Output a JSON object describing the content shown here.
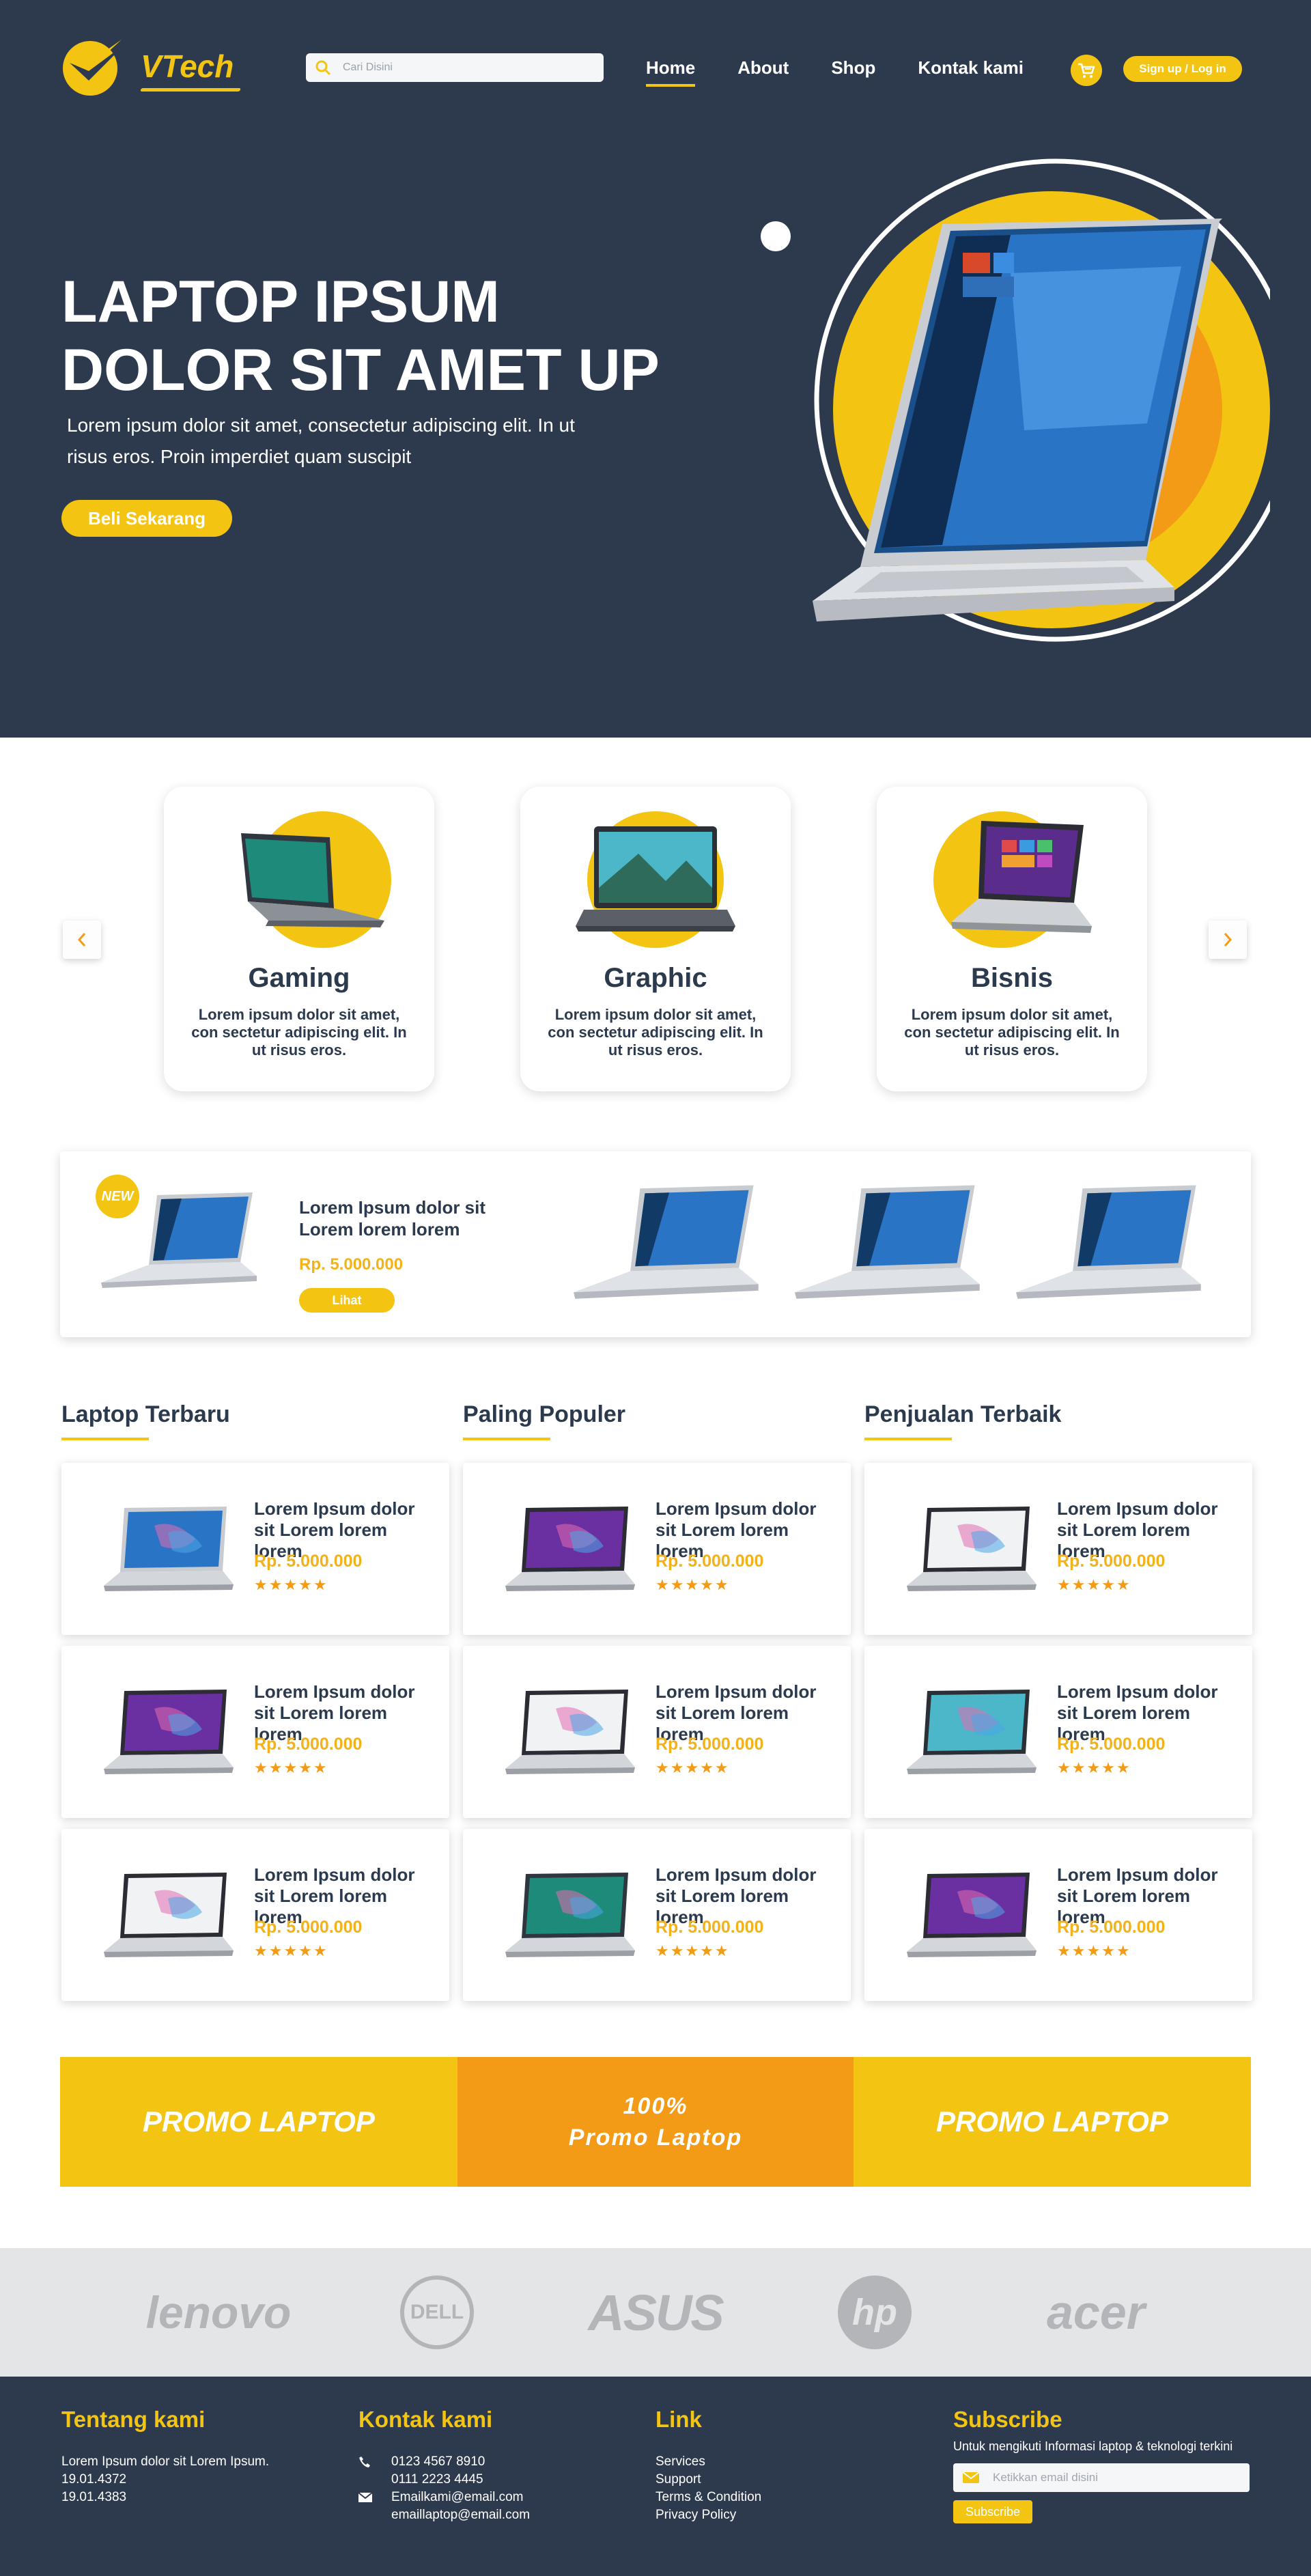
{
  "brand": {
    "name": "VTech"
  },
  "search": {
    "placeholder": "Cari Disini"
  },
  "nav": {
    "items": [
      "Home",
      "About",
      "Shop",
      "Kontak kami"
    ],
    "active": "Home"
  },
  "header": {
    "signin_label": "Sign up / Log in"
  },
  "hero": {
    "title_line1": "LAPTOP IPSUM",
    "title_line2": "DOLOR SIT AMET UP",
    "text": "Lorem ipsum dolor sit amet, consectetur adipiscing elit. In ut risus eros. Proin imperdiet quam suscipit",
    "cta": "Beli Sekarang"
  },
  "categories": [
    {
      "title": "Gaming",
      "desc": "Lorem ipsum dolor sit amet, con sectetur adipiscing elit. In ut risus eros."
    },
    {
      "title": "Graphic",
      "desc": "Lorem ipsum dolor sit amet, con sectetur adipiscing elit. In ut risus eros."
    },
    {
      "title": "Bisnis",
      "desc": "Lorem ipsum dolor sit amet, con sectetur adipiscing elit. In ut risus eros."
    }
  ],
  "featured": {
    "badge": "NEW",
    "title": "Lorem Ipsum dolor sit Lorem lorem lorem",
    "price": "Rp. 5.000.000",
    "button": "Lihat"
  },
  "lists": {
    "titles": [
      "Laptop Terbaru",
      "Paling Populer",
      "Penjualan Terbaik"
    ],
    "product_name": "Lorem Ipsum dolor sit Lorem lorem lorem",
    "product_price": "Rp. 5.000.000",
    "rating": 5,
    "stars": "★★★★★"
  },
  "promo": {
    "left": "PROMO LAPTOP",
    "center_line1": "100%",
    "center_line2": "Promo Laptop",
    "right": "PROMO LAPTOP"
  },
  "brands": [
    "lenovo",
    "DELL",
    "ASUS",
    "hp",
    "acer"
  ],
  "footer": {
    "about": {
      "title": "Tentang kami",
      "lines": [
        "Lorem Ipsum dolor sit Lorem Ipsum.",
        "19.01.4372",
        "19.01.4383"
      ]
    },
    "contact": {
      "title": "Kontak kami",
      "phone1": "0123 4567 8910",
      "phone2": "0111 2223 4445",
      "email1": "Emailkami@email.com",
      "email2": "emaillaptop@email.com"
    },
    "links": {
      "title": "Link",
      "items": [
        "Services",
        "Support",
        "Terms & Condition",
        "Privacy Policy"
      ]
    },
    "subscribe": {
      "title": "Subscribe",
      "desc": "Untuk mengikuti Informasi laptop & teknologi terkini",
      "placeholder": "Ketikkan email disini",
      "button": "Subscribe"
    }
  },
  "colors": {
    "navy": "#2d3a4e",
    "yellow": "#f3c512",
    "orange": "#f39a16"
  }
}
